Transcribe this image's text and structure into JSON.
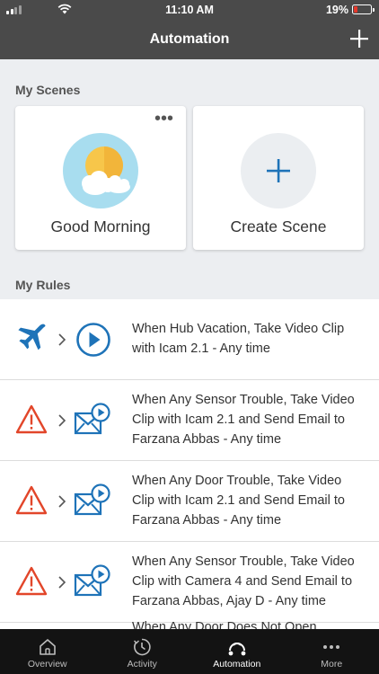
{
  "status_bar": {
    "time": "11:10 AM",
    "battery": "19%"
  },
  "header": {
    "title": "Automation",
    "add_icon": "plus-icon"
  },
  "scenes": {
    "title": "My Scenes",
    "items": [
      {
        "label": "Good Morning",
        "icon": "sun-cloud-icon"
      },
      {
        "label": "Create Scene",
        "icon": "plus-icon"
      }
    ]
  },
  "rules": {
    "title": "My Rules",
    "items": [
      {
        "trigger_icon": "airplane-icon",
        "action_icon": "play-icon",
        "text": "When Hub Vacation, Take Video Clip with Icam 2.1 - Any time"
      },
      {
        "trigger_icon": "warning-icon",
        "action_icon": "email-video-icon",
        "text": "When Any Sensor Trouble, Take Video Clip with Icam 2.1 and Send Email to Farzana Abbas - Any time"
      },
      {
        "trigger_icon": "warning-icon",
        "action_icon": "email-video-icon",
        "text": "When Any Door Trouble, Take Video Clip with Icam 2.1 and Send Email to Farzana Abbas - Any time"
      },
      {
        "trigger_icon": "warning-icon",
        "action_icon": "email-video-icon",
        "text": "When Any Sensor Trouble, Take Video Clip with Camera 4 and Send Email to Farzana Abbas, Ajay D - Any time"
      },
      {
        "trigger_icon": "door-icon",
        "action_icon": "email-video-icon",
        "text": "When Any Door Does Not Open"
      }
    ]
  },
  "tabs": [
    {
      "label": "Overview",
      "icon": "home-icon",
      "active": false
    },
    {
      "label": "Activity",
      "icon": "clock-icon",
      "active": false
    },
    {
      "label": "Automation",
      "icon": "automation-icon",
      "active": true
    },
    {
      "label": "More",
      "icon": "more-icon",
      "active": false
    }
  ],
  "colors": {
    "header": "#4a4a4a",
    "accent_blue": "#1e73b8",
    "warning_orange": "#e2462a",
    "tab_bar": "#131313"
  }
}
